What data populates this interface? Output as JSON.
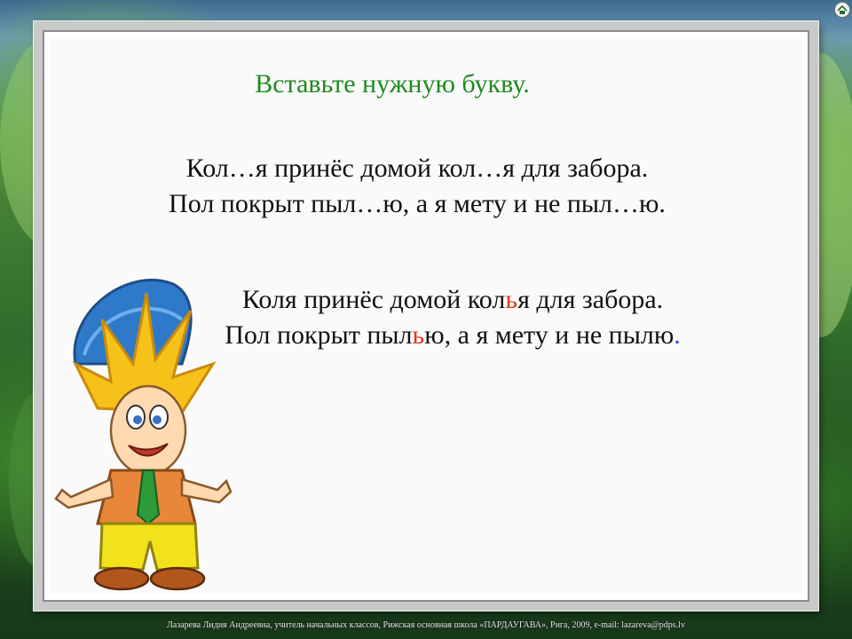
{
  "slide": {
    "title": "Вставьте нужную букву.",
    "question_lines": [
      "Кол…я принёс домой кол…я для забора.",
      "Пол покрыт пыл…ю, а я мету и не пыл…ю."
    ],
    "answer_line1": {
      "before": "Коля принёс домой кол",
      "highlight": "ь",
      "after": "я для забора."
    },
    "answer_line2": {
      "before": "Пол покрыт пыл",
      "highlight": "ь",
      "middle": "ю, а я мету и не пылю",
      "end_dot": "."
    },
    "footer": "Лазарева  Лидия Андреевна,  учитель начальных классов,  Рижская основная школа «ПАРДАУГАВА»,   Рига,   2009,   e-mail: lazareva@pdps.lv"
  },
  "colors": {
    "title": "#1e8a1e",
    "highlight": "#e03a1a",
    "dot": "#2a56d6"
  },
  "icons": {
    "nav": "home-nav-icon",
    "character": "cartoon-boy-illustration"
  }
}
